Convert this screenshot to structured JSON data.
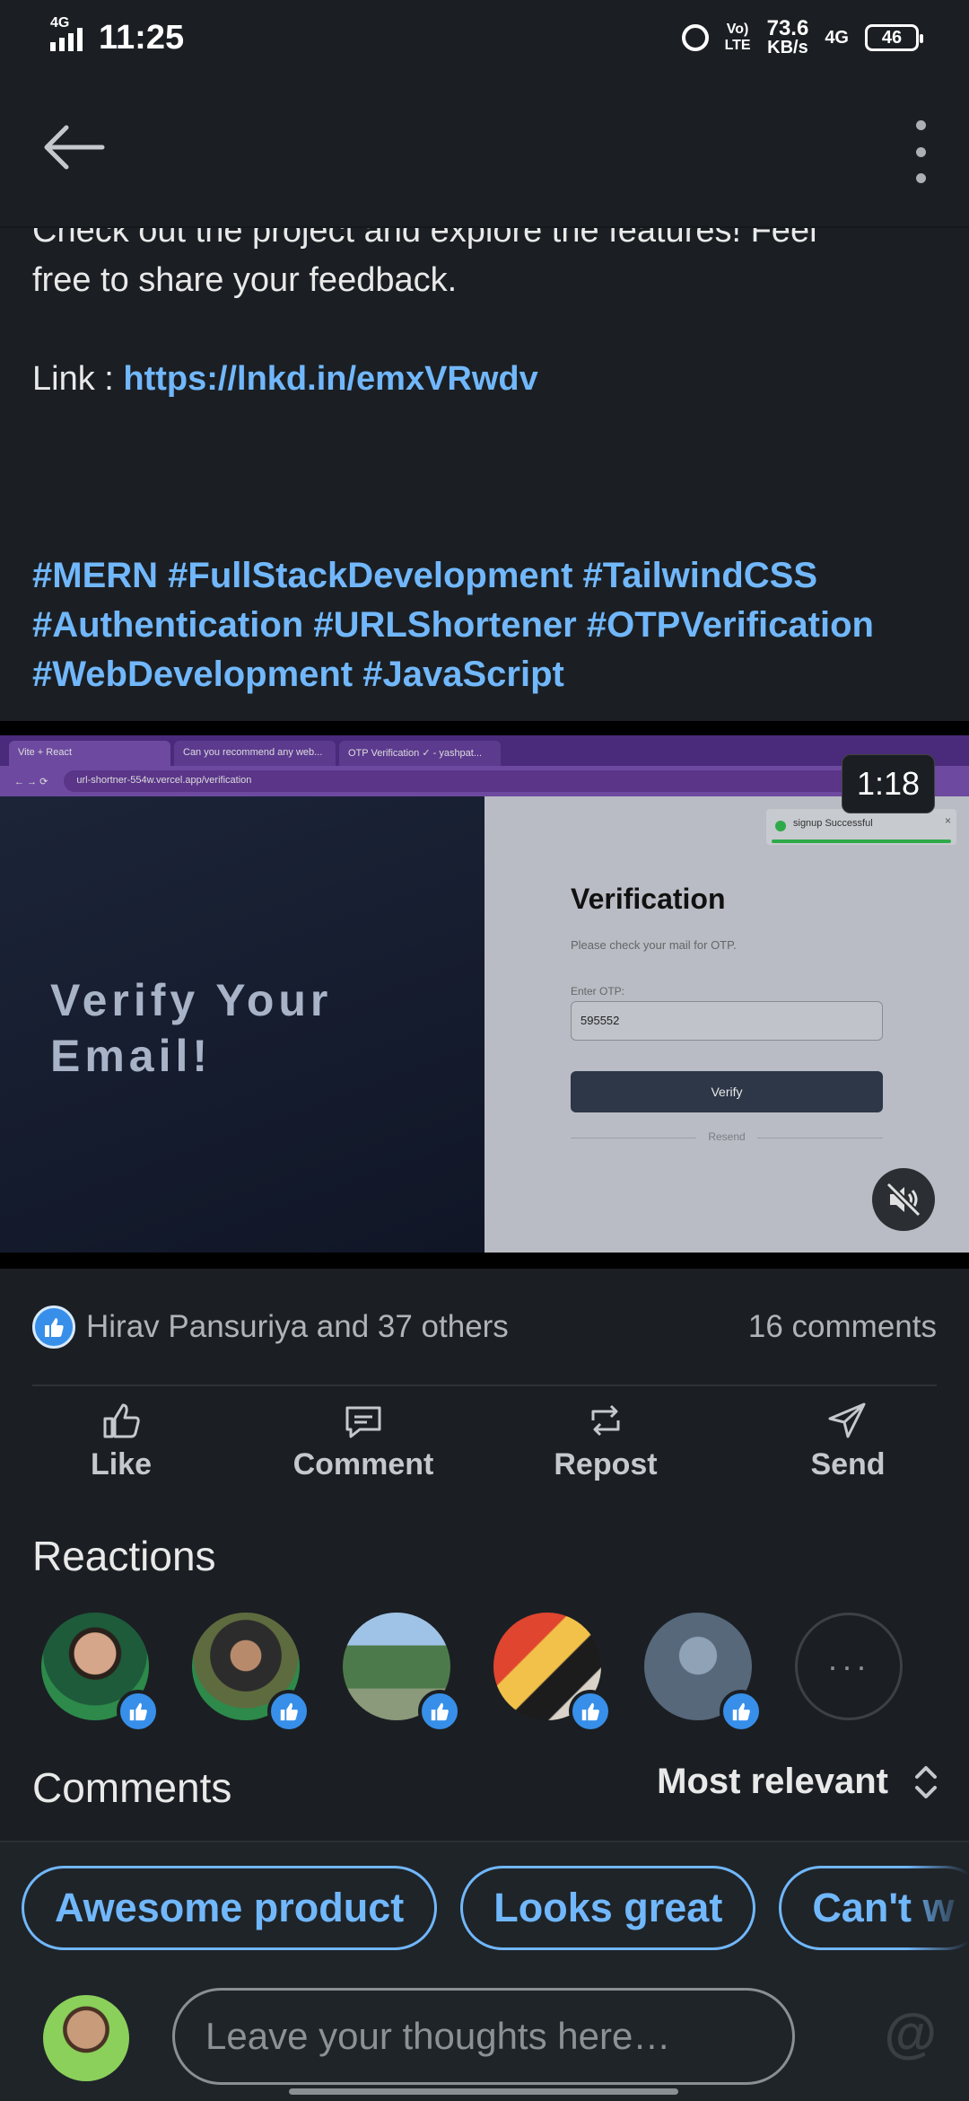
{
  "status_bar": {
    "network_tag": "4G",
    "time": "11:25",
    "volte_top": "Vo)",
    "volte_bottom": "LTE",
    "speed_value": "73.6",
    "speed_unit": "KB/s",
    "network_right": "4G",
    "battery": "46"
  },
  "post": {
    "text_line_clipped": "Check out the project and explore the features! Feel",
    "text_line": "free to share your feedback.",
    "link_label": "Link : ",
    "link_url": "https://lnkd.in/emxVRwdv",
    "hashtags_line1": "#MERN #FullStackDevelopment #TailwindCSS",
    "hashtags_line2": "#Authentication #URLShortener #OTPVerification",
    "hashtags_line3": "#WebDevelopment #JavaScript"
  },
  "video": {
    "timer": "1:18",
    "browser_tabs": [
      "Vite + React",
      "Can you recommend any web...",
      "OTP Verification ✓ - yashpat..."
    ],
    "url": "url-shortner-554w.vercel.app/verification",
    "left_title_line1": "Verify Your",
    "left_title_line2": "Email!",
    "toast_text": "signup Successful",
    "card_title": "Verification",
    "card_subtitle": "Please check your mail for OTP.",
    "otp_label": "Enter OTP:",
    "otp_value": "595552",
    "verify_button": "Verify",
    "resend": "Resend"
  },
  "social": {
    "likes_text": "Hirav Pansuriya and 37 others",
    "comments_count": "16 comments"
  },
  "actions": {
    "like": "Like",
    "comment": "Comment",
    "repost": "Repost",
    "send": "Send"
  },
  "reactions": {
    "heading": "Reactions",
    "more": "···"
  },
  "comments": {
    "heading": "Comments",
    "sort_label": "Most relevant"
  },
  "suggestions": [
    "Awesome product",
    "Looks great",
    "Can't w"
  ],
  "composer": {
    "placeholder": "Leave your thoughts here…",
    "mention_icon": "@"
  },
  "colors": {
    "background": "#1b1f23",
    "link": "#71b7fb",
    "like_blue": "#378fe9"
  }
}
